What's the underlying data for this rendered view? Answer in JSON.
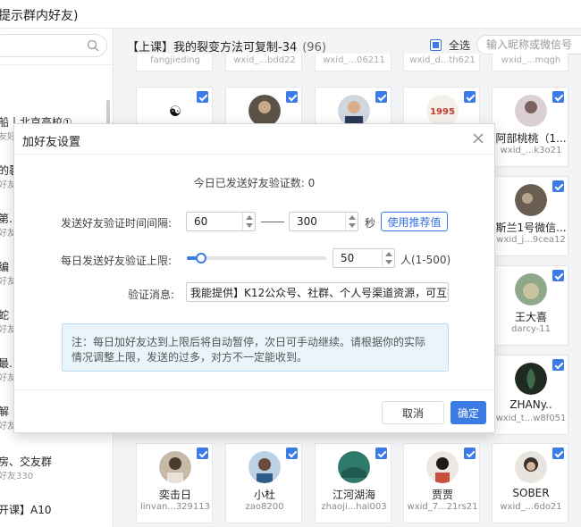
{
  "window": {
    "title": "提示群内好友)"
  },
  "sidebar": {
    "search": {
      "placeholder": ""
    },
    "groups": [
      {
        "name": "船丨北京高校①",
        "sub": "友好友"
      },
      {
        "name": "的裂",
        "sub": "好友"
      },
      {
        "name": "第.",
        "sub": "好友"
      },
      {
        "name": "编",
        "sub": "好友"
      },
      {
        "name": "蛇",
        "sub": "好友"
      },
      {
        "name": "最.",
        "sub": "好友"
      },
      {
        "name": "解",
        "sub": "好友"
      },
      {
        "name": "房、交友群",
        "sub": "好友330"
      },
      {
        "name": "开课】A10",
        "sub": ""
      }
    ]
  },
  "main": {
    "group_title": "【上课】我的裂变方法可复制-34",
    "group_count": "(96)",
    "select_all_label": "全选",
    "friend_search_placeholder": "输入昵称或微信号",
    "top_row_ids": [
      "fangjieding",
      "wxid_...bdd22",
      "wxid_...06211",
      "wxid_d...th621",
      "wxid_...mqgh"
    ],
    "friends": [
      {
        "name": "",
        "id": "",
        "checked": true
      },
      {
        "name": "",
        "id": "",
        "checked": true
      },
      {
        "name": "",
        "id": "",
        "checked": true
      },
      {
        "name": "",
        "id": "",
        "checked": true
      },
      {
        "name": "阿部桃桃（1...",
        "id": "wxid_...k3o21",
        "checked": true
      },
      {
        "name": "斯兰1号微信...",
        "id": "wxid_j...9cea12",
        "checked": true
      },
      {
        "name": "王大喜",
        "id": "darcy-11",
        "checked": true
      },
      {
        "name": "ZHANy..",
        "id": "wxid_t...w8f051",
        "checked": true
      },
      {
        "name": "奕击日",
        "id": "linvan...329113",
        "checked": true
      },
      {
        "name": "小杜",
        "id": "zao8200",
        "checked": true
      },
      {
        "name": "江河湖海",
        "id": "zhaoji...hai003",
        "checked": true
      },
      {
        "name": "贾贾",
        "id": "wxid_7...21rs21",
        "checked": true
      },
      {
        "name": "SOBER",
        "id": "wxid_...6do21",
        "checked": true
      }
    ]
  },
  "modal": {
    "title": "加好友设置",
    "sent_today": "今日已发送好友验证数:  0",
    "interval_label": "发送好友验证时间间隔:",
    "interval_min": "60",
    "interval_max": "300",
    "interval_unit": "秒",
    "recommend_label": "使用推荐值",
    "daily_limit_label": "每日发送好友验证上限:",
    "daily_limit_value": "50",
    "daily_limit_fraction": 0.1,
    "daily_limit_unit": "人(1-500)",
    "message_label": "验证消息:",
    "message_value": "我能提供】K12公众号、社群、个人号渠道资源，可互推",
    "note_line1": "注：每日加好友达到上限后将自动暂停，次日可手动继续。请根据你的实际",
    "note_line2": "情况调整上限，发送的过多，对方不一定能收到。",
    "cancel_label": "取消",
    "confirm_label": "确定"
  },
  "colors": {
    "accent": "#3b7be6",
    "note_bg": "#e9f4fb"
  },
  "icons": [
    "search-icon",
    "close-icon",
    "checkbox-icon",
    "avatar"
  ]
}
